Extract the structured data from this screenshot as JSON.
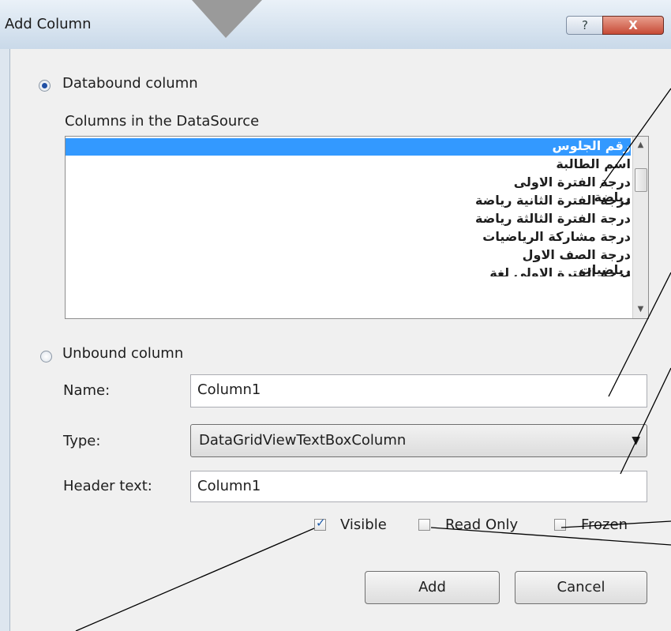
{
  "window": {
    "title": "Add Column",
    "help_label": "?",
    "close_label": "X"
  },
  "databound": {
    "label": "Databound column",
    "selected": true,
    "list_label": "Columns in the DataSource",
    "items": [
      "رقم الجلوس",
      "اسم الطالبة",
      "درجة الفترة الاولى رياضة",
      "درجة الفترة الثانية رياضة",
      "درجة الفترة الثالثة رياضة",
      "درجة مشاركة الرياضيات",
      "درجة الصف الاول رياضيات",
      "درجة الفترة الاولى لغة انجليزية"
    ],
    "selected_index": 0
  },
  "unbound": {
    "label": "Unbound column",
    "selected": false
  },
  "form": {
    "name_label": "Name:",
    "name_value": "Column1",
    "type_label": "Type:",
    "type_value": "DataGridViewTextBoxColumn",
    "header_label": "Header text:",
    "header_value": "Column1"
  },
  "options": {
    "visible_label": "Visible",
    "visible_checked": true,
    "readonly_label": "Read Only",
    "readonly_checked": false,
    "frozen_label": "Frozen",
    "frozen_checked": false
  },
  "buttons": {
    "add": "Add",
    "cancel": "Cancel"
  },
  "colors": {
    "selection": "#3399ff",
    "title_bar": "#dbe6f1",
    "close_button": "#c74a35"
  }
}
